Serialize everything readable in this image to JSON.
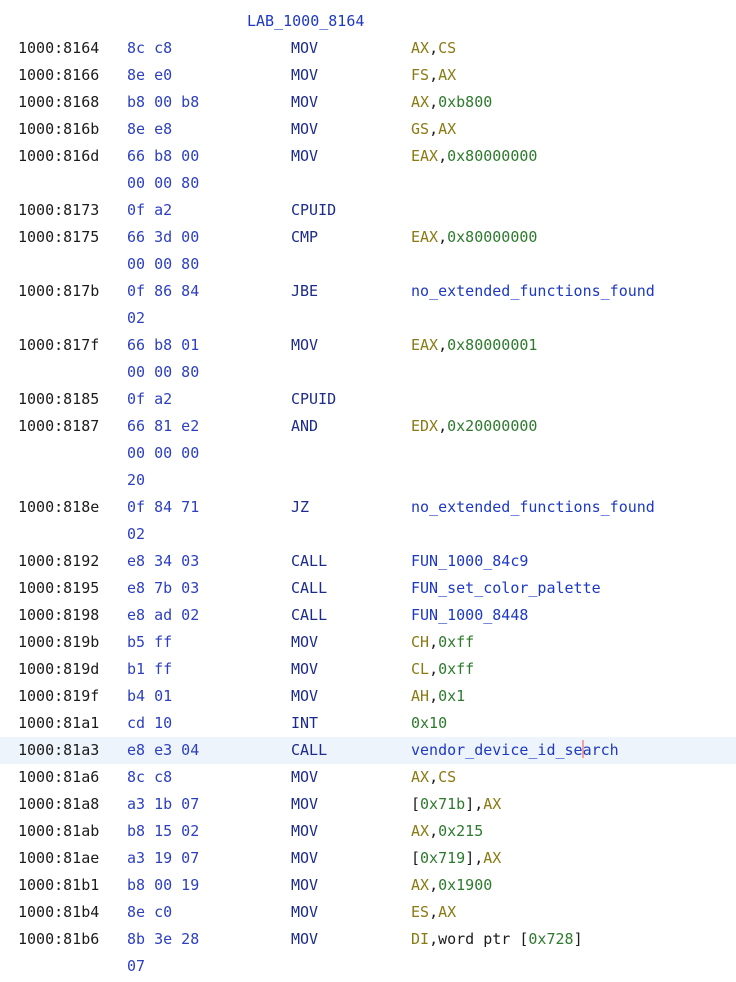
{
  "listing": {
    "label": "LAB_1000_8164",
    "selected_index": 26,
    "rows": [
      {
        "addr": "1000:8164",
        "bytes": "8c c8",
        "mnemonic": "MOV",
        "operands": [
          {
            "t": "AX",
            "k": "reg"
          },
          {
            "t": ",",
            "k": "punct"
          },
          {
            "t": "CS",
            "k": "reg"
          }
        ]
      },
      {
        "addr": "1000:8166",
        "bytes": "8e e0",
        "mnemonic": "MOV",
        "operands": [
          {
            "t": "FS",
            "k": "reg"
          },
          {
            "t": ",",
            "k": "punct"
          },
          {
            "t": "AX",
            "k": "reg"
          }
        ]
      },
      {
        "addr": "1000:8168",
        "bytes": "b8 00 b8",
        "mnemonic": "MOV",
        "operands": [
          {
            "t": "AX",
            "k": "reg"
          },
          {
            "t": ",",
            "k": "punct"
          },
          {
            "t": "0xb800",
            "k": "num"
          }
        ]
      },
      {
        "addr": "1000:816b",
        "bytes": "8e e8",
        "mnemonic": "MOV",
        "operands": [
          {
            "t": "GS",
            "k": "reg"
          },
          {
            "t": ",",
            "k": "punct"
          },
          {
            "t": "AX",
            "k": "reg"
          }
        ]
      },
      {
        "addr": "1000:816d",
        "bytes": "66 b8 00",
        "mnemonic": "MOV",
        "operands": [
          {
            "t": "EAX",
            "k": "reg"
          },
          {
            "t": ",",
            "k": "punct"
          },
          {
            "t": "0x80000000",
            "k": "num"
          }
        ]
      },
      {
        "addr": "",
        "bytes": "00 00 80",
        "mnemonic": "",
        "operands": []
      },
      {
        "addr": "1000:8173",
        "bytes": "0f a2",
        "mnemonic": "CPUID",
        "operands": []
      },
      {
        "addr": "1000:8175",
        "bytes": "66 3d 00",
        "mnemonic": "CMP",
        "operands": [
          {
            "t": "EAX",
            "k": "reg"
          },
          {
            "t": ",",
            "k": "punct"
          },
          {
            "t": "0x80000000",
            "k": "num"
          }
        ]
      },
      {
        "addr": "",
        "bytes": "00 00 80",
        "mnemonic": "",
        "operands": []
      },
      {
        "addr": "1000:817b",
        "bytes": "0f 86 84",
        "mnemonic": "JBE",
        "operands": [
          {
            "t": "no_extended_functions_found",
            "k": "ref"
          }
        ]
      },
      {
        "addr": "",
        "bytes": "02",
        "mnemonic": "",
        "operands": []
      },
      {
        "addr": "1000:817f",
        "bytes": "66 b8 01",
        "mnemonic": "MOV",
        "operands": [
          {
            "t": "EAX",
            "k": "reg"
          },
          {
            "t": ",",
            "k": "punct"
          },
          {
            "t": "0x80000001",
            "k": "num"
          }
        ]
      },
      {
        "addr": "",
        "bytes": "00 00 80",
        "mnemonic": "",
        "operands": []
      },
      {
        "addr": "1000:8185",
        "bytes": "0f a2",
        "mnemonic": "CPUID",
        "operands": []
      },
      {
        "addr": "1000:8187",
        "bytes": "66 81 e2",
        "mnemonic": "AND",
        "operands": [
          {
            "t": "EDX",
            "k": "reg"
          },
          {
            "t": ",",
            "k": "punct"
          },
          {
            "t": "0x20000000",
            "k": "num"
          }
        ]
      },
      {
        "addr": "",
        "bytes": "00 00 00",
        "mnemonic": "",
        "operands": []
      },
      {
        "addr": "",
        "bytes": "20",
        "mnemonic": "",
        "operands": []
      },
      {
        "addr": "1000:818e",
        "bytes": "0f 84 71",
        "mnemonic": "JZ",
        "operands": [
          {
            "t": "no_extended_functions_found",
            "k": "ref"
          }
        ]
      },
      {
        "addr": "",
        "bytes": "02",
        "mnemonic": "",
        "operands": []
      },
      {
        "addr": "1000:8192",
        "bytes": "e8 34 03",
        "mnemonic": "CALL",
        "operands": [
          {
            "t": "FUN_1000_84c9",
            "k": "ref"
          }
        ]
      },
      {
        "addr": "1000:8195",
        "bytes": "e8 7b 03",
        "mnemonic": "CALL",
        "operands": [
          {
            "t": "FUN_set_color_palette",
            "k": "ref"
          }
        ]
      },
      {
        "addr": "1000:8198",
        "bytes": "e8 ad 02",
        "mnemonic": "CALL",
        "operands": [
          {
            "t": "FUN_1000_8448",
            "k": "ref"
          }
        ]
      },
      {
        "addr": "1000:819b",
        "bytes": "b5 ff",
        "mnemonic": "MOV",
        "operands": [
          {
            "t": "CH",
            "k": "reg"
          },
          {
            "t": ",",
            "k": "punct"
          },
          {
            "t": "0xff",
            "k": "num"
          }
        ]
      },
      {
        "addr": "1000:819d",
        "bytes": "b1 ff",
        "mnemonic": "MOV",
        "operands": [
          {
            "t": "CL",
            "k": "reg"
          },
          {
            "t": ",",
            "k": "punct"
          },
          {
            "t": "0xff",
            "k": "num"
          }
        ]
      },
      {
        "addr": "1000:819f",
        "bytes": "b4 01",
        "mnemonic": "MOV",
        "operands": [
          {
            "t": "AH",
            "k": "reg"
          },
          {
            "t": ",",
            "k": "punct"
          },
          {
            "t": "0x1",
            "k": "num"
          }
        ]
      },
      {
        "addr": "1000:81a1",
        "bytes": "cd 10",
        "mnemonic": "INT",
        "operands": [
          {
            "t": "0x10",
            "k": "num"
          }
        ]
      },
      {
        "addr": "1000:81a3",
        "bytes": "e8 e3 04",
        "mnemonic": "CALL",
        "operands": [
          {
            "t": "vendor_device_id_se",
            "k": "ref"
          },
          {
            "t": "",
            "k": "caret"
          },
          {
            "t": "arch",
            "k": "ref"
          }
        ]
      },
      {
        "addr": "1000:81a6",
        "bytes": "8c c8",
        "mnemonic": "MOV",
        "operands": [
          {
            "t": "AX",
            "k": "reg"
          },
          {
            "t": ",",
            "k": "punct"
          },
          {
            "t": "CS",
            "k": "reg"
          }
        ]
      },
      {
        "addr": "1000:81a8",
        "bytes": "a3 1b 07",
        "mnemonic": "MOV",
        "operands": [
          {
            "t": "[",
            "k": "punct"
          },
          {
            "t": "0x71b",
            "k": "num"
          },
          {
            "t": "],",
            "k": "punct"
          },
          {
            "t": "AX",
            "k": "reg"
          }
        ]
      },
      {
        "addr": "1000:81ab",
        "bytes": "b8 15 02",
        "mnemonic": "MOV",
        "operands": [
          {
            "t": "AX",
            "k": "reg"
          },
          {
            "t": ",",
            "k": "punct"
          },
          {
            "t": "0x215",
            "k": "num"
          }
        ]
      },
      {
        "addr": "1000:81ae",
        "bytes": "a3 19 07",
        "mnemonic": "MOV",
        "operands": [
          {
            "t": "[",
            "k": "punct"
          },
          {
            "t": "0x719",
            "k": "num"
          },
          {
            "t": "],",
            "k": "punct"
          },
          {
            "t": "AX",
            "k": "reg"
          }
        ]
      },
      {
        "addr": "1000:81b1",
        "bytes": "b8 00 19",
        "mnemonic": "MOV",
        "operands": [
          {
            "t": "AX",
            "k": "reg"
          },
          {
            "t": ",",
            "k": "punct"
          },
          {
            "t": "0x1900",
            "k": "num"
          }
        ]
      },
      {
        "addr": "1000:81b4",
        "bytes": "8e c0",
        "mnemonic": "MOV",
        "operands": [
          {
            "t": "ES",
            "k": "reg"
          },
          {
            "t": ",",
            "k": "punct"
          },
          {
            "t": "AX",
            "k": "reg"
          }
        ]
      },
      {
        "addr": "1000:81b6",
        "bytes": "8b 3e 28",
        "mnemonic": "MOV",
        "operands": [
          {
            "t": "DI",
            "k": "reg"
          },
          {
            "t": ",",
            "k": "punct"
          },
          {
            "t": "word ptr ",
            "k": "text"
          },
          {
            "t": "[",
            "k": "punct"
          },
          {
            "t": "0x728",
            "k": "num"
          },
          {
            "t": "]",
            "k": "punct"
          }
        ]
      },
      {
        "addr": "",
        "bytes": "07",
        "mnemonic": "",
        "operands": []
      }
    ]
  }
}
